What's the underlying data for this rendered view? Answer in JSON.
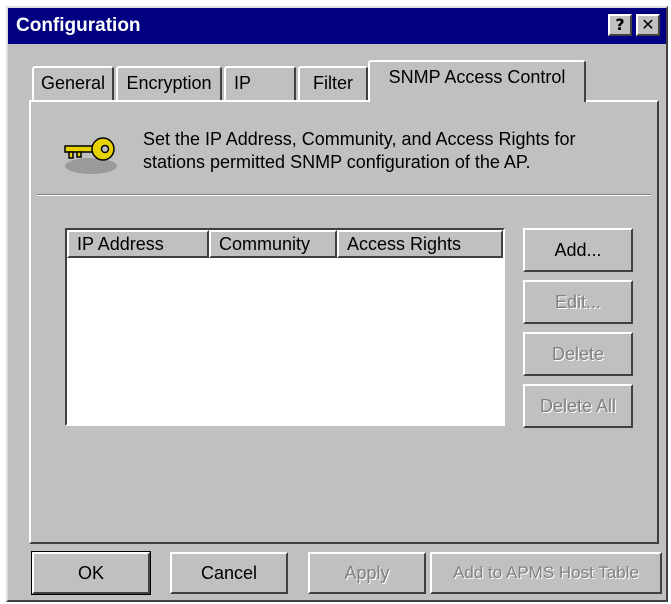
{
  "window": {
    "title": "Configuration",
    "help_label": "?",
    "close_label": "✕"
  },
  "tabs": [
    {
      "label": "General"
    },
    {
      "label": "Encryption"
    },
    {
      "label": "IP"
    },
    {
      "label": "Filter"
    },
    {
      "label": "SNMP Access Control"
    }
  ],
  "active_tab": "SNMP Access Control",
  "description": "Set the IP Address, Community, and Access Rights for stations permitted SNMP configuration of the AP.",
  "list": {
    "columns": [
      "IP Address",
      "Community",
      "Access Rights"
    ],
    "rows": []
  },
  "side_buttons": [
    {
      "label": "Add...",
      "enabled": true
    },
    {
      "label": "Edit...",
      "enabled": false
    },
    {
      "label": "Delete",
      "enabled": false
    },
    {
      "label": "Delete All",
      "enabled": false
    }
  ],
  "bottom_buttons": [
    {
      "label": "OK",
      "enabled": true
    },
    {
      "label": "Cancel",
      "enabled": true
    },
    {
      "label": "Apply",
      "enabled": false
    },
    {
      "label": "Add to APMS Host Table",
      "enabled": false
    }
  ],
  "icons": {
    "header_icon": "key-icon"
  },
  "colors": {
    "titlebar": "#000080",
    "face": "#c0c0c0",
    "key": "#e6d200"
  }
}
